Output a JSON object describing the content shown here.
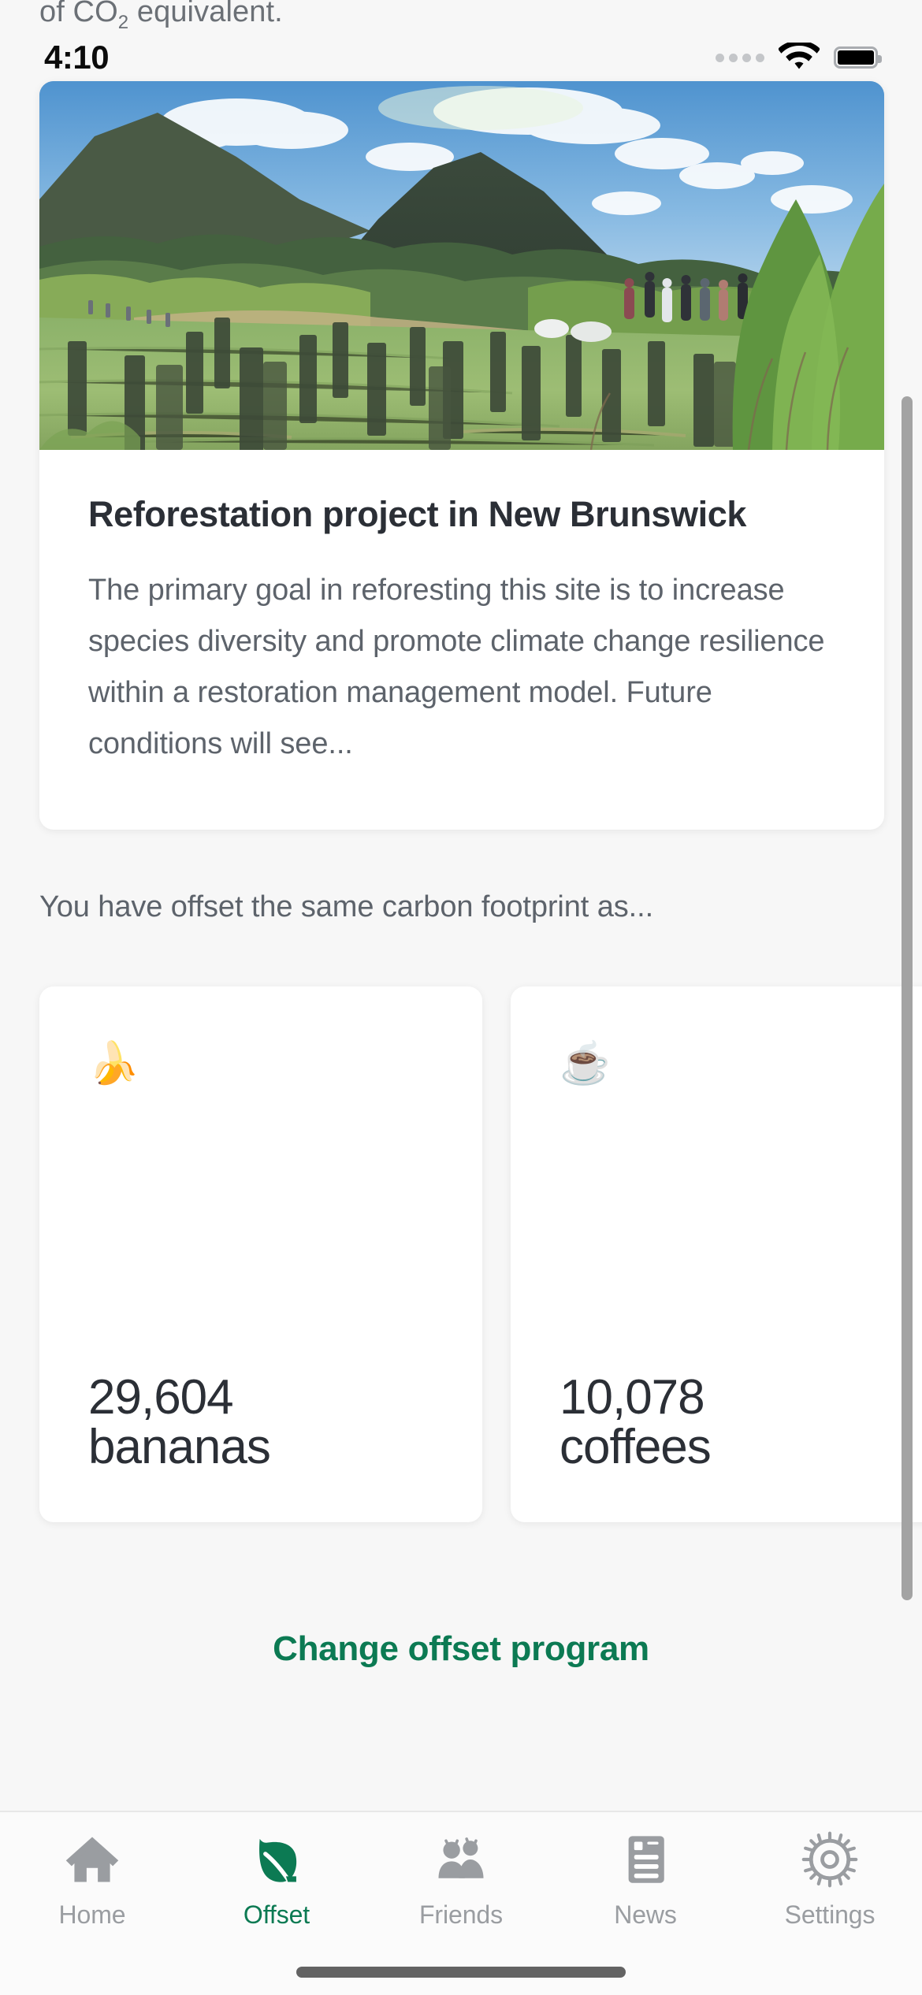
{
  "app": {
    "background_color": "#f7f7f7",
    "accent_color": "#0c7a53",
    "card_color": "#ffffff"
  },
  "top_fragment": {
    "prefix": "of CO",
    "subscript": "2",
    "suffix": " equivalent."
  },
  "status_bar": {
    "time": "4:10",
    "signal_icon": "signal-dots-icon",
    "wifi_icon": "wifi-icon",
    "battery_icon": "battery-full-icon"
  },
  "project_card": {
    "photo_alt": "reforestation-site-photo",
    "title": "Reforestation project in New Brunswick",
    "description": "The primary goal in reforesting this site is to increase species diversity and promote climate change resilience within a restoration management model. Future conditions will see..."
  },
  "offset_section": {
    "label": "You have offset the same carbon footprint as...",
    "cards": [
      {
        "emoji": "🍌",
        "icon_name": "banana-emoji",
        "value": "29,604",
        "unit": "bananas"
      },
      {
        "emoji": "☕",
        "icon_name": "coffee-emoji",
        "value": "10,078",
        "unit": "coffees"
      }
    ]
  },
  "change_program": {
    "label": "Change offset program"
  },
  "tabbar": {
    "items": [
      {
        "label": "Home",
        "icon": "home-icon",
        "active": false
      },
      {
        "label": "Offset",
        "icon": "leaf-icon",
        "active": true
      },
      {
        "label": "Friends",
        "icon": "people-icon",
        "active": false
      },
      {
        "label": "News",
        "icon": "newspaper-icon",
        "active": false
      },
      {
        "label": "Settings",
        "icon": "gear-icon",
        "active": false
      }
    ]
  }
}
